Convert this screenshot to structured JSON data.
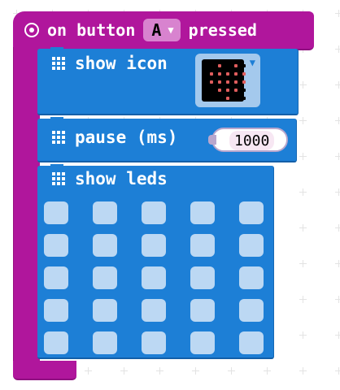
{
  "event": {
    "prefix": "on button",
    "button_value": "A",
    "suffix": "pressed",
    "color": "#b0169c"
  },
  "show_icon": {
    "label": "show icon",
    "icon_name": "heart",
    "led_color": "#e05d5d",
    "icon_rows": [
      [
        0,
        1,
        0,
        1,
        0
      ],
      [
        1,
        1,
        1,
        1,
        1
      ],
      [
        1,
        1,
        1,
        1,
        1
      ],
      [
        0,
        1,
        1,
        1,
        0
      ],
      [
        0,
        0,
        1,
        0,
        0
      ]
    ]
  },
  "pause": {
    "label": "pause (ms)",
    "value": "1000"
  },
  "show_leds": {
    "label": "show leds",
    "rows": 5,
    "cols": 5,
    "lit_count": 0
  },
  "colors": {
    "block_blue": "#1d7fd6",
    "led_off": "#bcd8f3"
  }
}
